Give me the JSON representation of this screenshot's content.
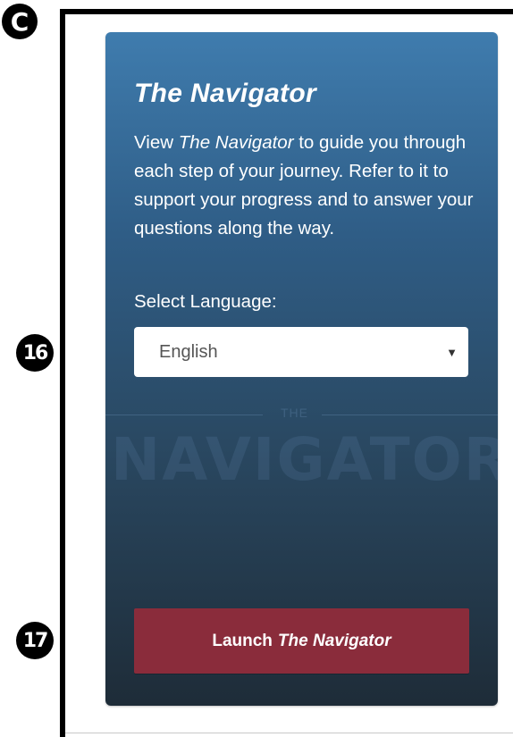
{
  "markers": {
    "c": "C",
    "select": "16",
    "launch": "17"
  },
  "navigator_card": {
    "title": "The Navigator",
    "description": {
      "prefix": "View ",
      "emphasis": "The Navigator",
      "suffix": " to guide you through each step of your journey. Refer to it to support your progress and to answer your questions along the way."
    },
    "language_label": "Select Language:",
    "language_select": {
      "selected": "English"
    },
    "watermark": {
      "small": "THE",
      "big": "NAVIGATOR"
    },
    "launch_button": {
      "prefix": "Launch",
      "emphasis": "The Navigator"
    }
  },
  "colors": {
    "card_top": "#3f7cae",
    "card_bottom": "#1e2c38",
    "launch_button": "#8a2c3b",
    "marker": "#000000"
  }
}
